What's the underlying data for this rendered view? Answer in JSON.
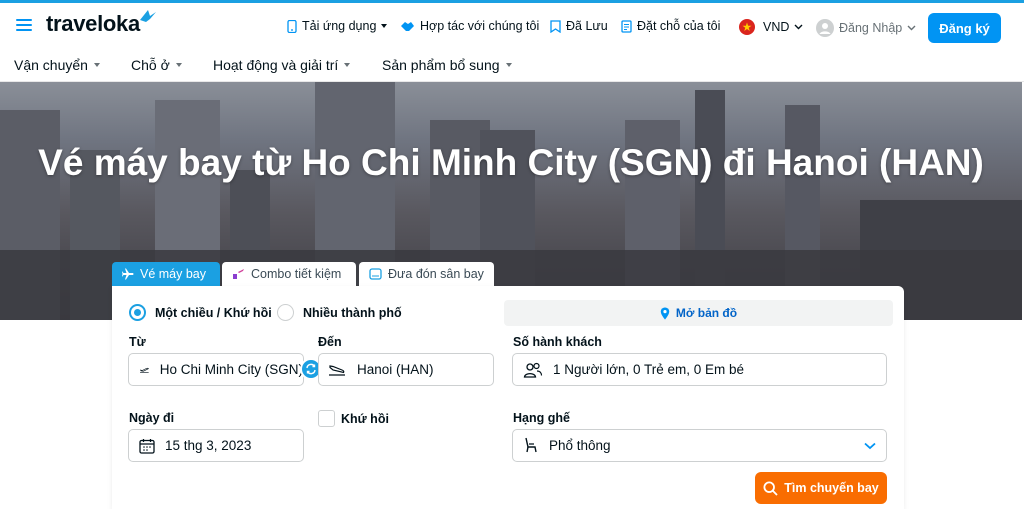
{
  "header": {
    "logo": "traveloka",
    "nav": {
      "app": "Tải ứng dụng",
      "partner": "Hợp tác với chúng tôi",
      "saved": "Đã Lưu",
      "bookings": "Đặt chỗ của tôi",
      "currency": "VND",
      "login": "Đăng Nhập",
      "register": "Đăng ký"
    }
  },
  "subnav": [
    "Vận chuyển",
    "Chỗ ở",
    "Hoạt động và giải trí",
    "Sản phẩm bổ sung"
  ],
  "hero": {
    "title": "Vé máy bay từ Ho Chi Minh City (SGN) đi Hanoi (HAN)"
  },
  "tabs": [
    "Vé máy bay",
    "Combo tiết kiệm",
    "Đưa đón sân bay"
  ],
  "form": {
    "trip_oneway": "Một chiều / Khứ hồi",
    "trip_multi": "Nhiều thành phố",
    "map": "Mở bản đồ",
    "from_label": "Từ",
    "from_value": "Ho Chi Minh City (SGN)",
    "to_label": "Đến",
    "to_value": "Hanoi (HAN)",
    "passengers_label": "Số hành khách",
    "passengers_value": "1 Người lớn, 0 Trẻ em, 0 Em bé",
    "date_label": "Ngày đi",
    "date_value": "15 thg 3, 2023",
    "return_label": "Khứ hồi",
    "class_label": "Hạng ghế",
    "class_value": "Phổ thông",
    "search": "Tìm chuyến bay"
  },
  "colors": {
    "primary": "#0194f3",
    "tab_active": "#1ba0e2",
    "search": "#f96d01"
  }
}
